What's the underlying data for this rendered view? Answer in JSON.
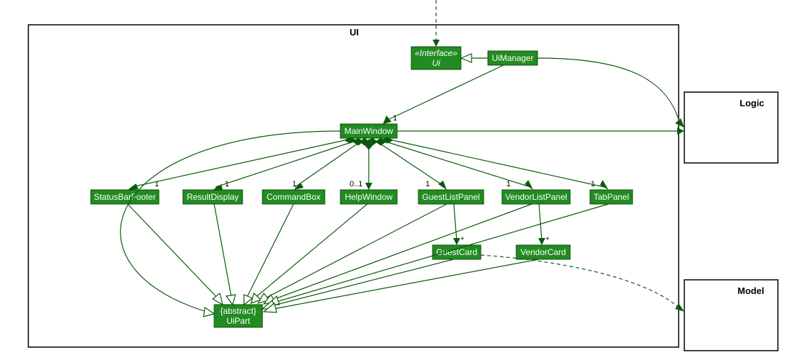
{
  "packages": {
    "ui": "UI",
    "logic": "Logic",
    "model": "Model"
  },
  "nodes": {
    "uiInterface": {
      "stereotype": "«Interface»",
      "name": "Ui"
    },
    "uiManager": "UiManager",
    "mainWindow": "MainWindow",
    "statusBarFooter": "StatusBarFooter",
    "resultDisplay": "ResultDisplay",
    "commandBox": "CommandBox",
    "helpWindow": "HelpWindow",
    "guestListPanel": "GuestListPanel",
    "vendorListPanel": "VendorListPanel",
    "tabPanel": "TabPanel",
    "guestCard": "GuestCard",
    "vendorCard": "VendorCard",
    "uiPart": {
      "stereotype": "{abstract}",
      "name": "UiPart"
    }
  },
  "multiplicities": {
    "mainWindow": "1",
    "statusBarFooter": "1",
    "resultDisplay": "1",
    "commandBox": "1",
    "helpWindow": "0..1",
    "guestListPanel": "1",
    "vendorListPanel": "1",
    "tabPanel": "1",
    "guestCard": "*",
    "vendorCard": "*"
  },
  "chart_data": {
    "type": "diagram",
    "diagram_type": "uml-class",
    "packages": [
      "UI",
      "Logic",
      "Model"
    ],
    "classes": [
      {
        "name": "Ui",
        "stereotype": "interface",
        "package": "UI"
      },
      {
        "name": "UiManager",
        "package": "UI"
      },
      {
        "name": "MainWindow",
        "package": "UI"
      },
      {
        "name": "StatusBarFooter",
        "package": "UI"
      },
      {
        "name": "ResultDisplay",
        "package": "UI"
      },
      {
        "name": "CommandBox",
        "package": "UI"
      },
      {
        "name": "HelpWindow",
        "package": "UI"
      },
      {
        "name": "GuestListPanel",
        "package": "UI"
      },
      {
        "name": "VendorListPanel",
        "package": "UI"
      },
      {
        "name": "TabPanel",
        "package": "UI"
      },
      {
        "name": "GuestCard",
        "package": "UI"
      },
      {
        "name": "VendorCard",
        "package": "UI"
      },
      {
        "name": "UiPart",
        "stereotype": "abstract",
        "package": "UI"
      }
    ],
    "relationships": [
      {
        "from": "UiManager",
        "to": "Ui",
        "type": "realization"
      },
      {
        "from": "UiManager",
        "to": "MainWindow",
        "type": "association",
        "multiplicity": "1"
      },
      {
        "from": "MainWindow",
        "to": "StatusBarFooter",
        "type": "composition",
        "multiplicity": "1"
      },
      {
        "from": "MainWindow",
        "to": "ResultDisplay",
        "type": "composition",
        "multiplicity": "1"
      },
      {
        "from": "MainWindow",
        "to": "CommandBox",
        "type": "composition",
        "multiplicity": "1"
      },
      {
        "from": "MainWindow",
        "to": "HelpWindow",
        "type": "composition",
        "multiplicity": "0..1"
      },
      {
        "from": "MainWindow",
        "to": "GuestListPanel",
        "type": "composition",
        "multiplicity": "1"
      },
      {
        "from": "MainWindow",
        "to": "VendorListPanel",
        "type": "composition",
        "multiplicity": "1"
      },
      {
        "from": "MainWindow",
        "to": "TabPanel",
        "type": "composition",
        "multiplicity": "1"
      },
      {
        "from": "GuestListPanel",
        "to": "GuestCard",
        "type": "association",
        "multiplicity": "*"
      },
      {
        "from": "VendorListPanel",
        "to": "VendorCard",
        "type": "association",
        "multiplicity": "*"
      },
      {
        "from": "MainWindow",
        "to": "UiPart",
        "type": "generalization"
      },
      {
        "from": "StatusBarFooter",
        "to": "UiPart",
        "type": "generalization"
      },
      {
        "from": "ResultDisplay",
        "to": "UiPart",
        "type": "generalization"
      },
      {
        "from": "CommandBox",
        "to": "UiPart",
        "type": "generalization"
      },
      {
        "from": "HelpWindow",
        "to": "UiPart",
        "type": "generalization"
      },
      {
        "from": "GuestListPanel",
        "to": "UiPart",
        "type": "generalization"
      },
      {
        "from": "VendorListPanel",
        "to": "UiPart",
        "type": "generalization"
      },
      {
        "from": "TabPanel",
        "to": "UiPart",
        "type": "generalization"
      },
      {
        "from": "GuestCard",
        "to": "UiPart",
        "type": "generalization"
      },
      {
        "from": "VendorCard",
        "to": "UiPart",
        "type": "generalization"
      },
      {
        "from": "UiManager",
        "to": "Logic",
        "type": "association"
      },
      {
        "from": "MainWindow",
        "to": "Logic",
        "type": "association"
      },
      {
        "from": "GuestCard",
        "to": "Model",
        "type": "dependency"
      },
      {
        "from": "external",
        "to": "Ui",
        "type": "dependency"
      }
    ]
  }
}
